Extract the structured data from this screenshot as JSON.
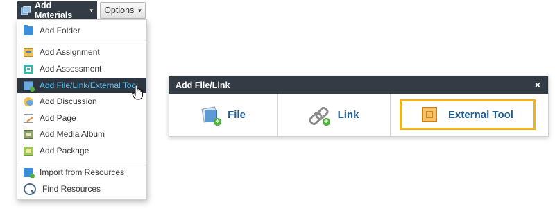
{
  "toolbar": {
    "add_materials_label": "Add Materials",
    "add_materials_caret": "▾",
    "options_label": "Options",
    "options_caret": "▾"
  },
  "menu": {
    "items": [
      {
        "label": "Add Folder",
        "icon": "folder-icon"
      },
      {
        "label": "Add Assignment",
        "icon": "assignment-icon"
      },
      {
        "label": "Add Assessment",
        "icon": "assessment-icon"
      },
      {
        "label": "Add File/Link/External Tool",
        "icon": "file-link-icon",
        "active": true
      },
      {
        "label": "Add Discussion",
        "icon": "discussion-icon"
      },
      {
        "label": "Add Page",
        "icon": "page-icon"
      },
      {
        "label": "Add Media Album",
        "icon": "media-album-icon"
      },
      {
        "label": "Add Package",
        "icon": "package-icon"
      },
      {
        "label": "Import from Resources",
        "icon": "import-icon"
      },
      {
        "label": "Find Resources",
        "icon": "search-icon"
      }
    ]
  },
  "dialog": {
    "title": "Add File/Link",
    "close_glyph": "×",
    "options": {
      "file": "File",
      "link": "Link",
      "external_tool": "External Tool"
    },
    "highlight_color": "#f2b316"
  },
  "colors": {
    "header_dark": "#333c45",
    "active_text": "#5cc4f0",
    "option_text": "#1f5d96"
  }
}
